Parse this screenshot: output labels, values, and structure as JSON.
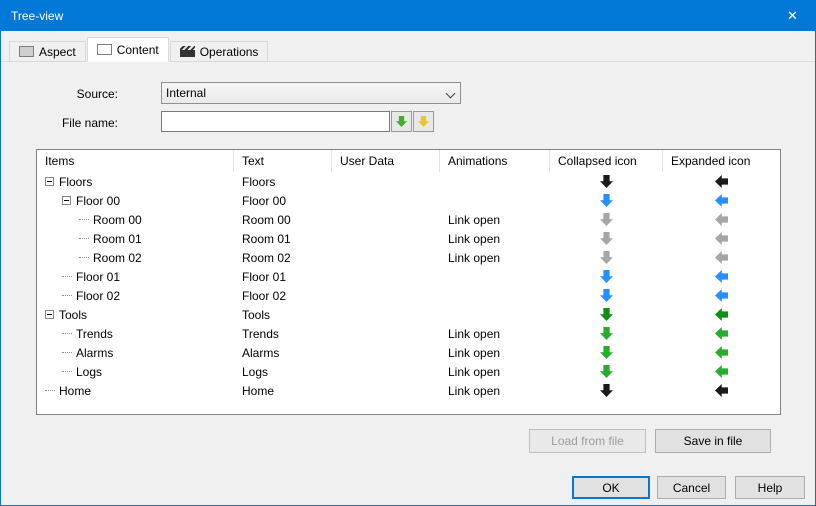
{
  "window": {
    "title": "Tree-view",
    "close_glyph": "✕"
  },
  "tabs": [
    {
      "label": "Aspect"
    },
    {
      "label": "Content"
    },
    {
      "label": "Operations"
    }
  ],
  "form": {
    "source_label": "Source:",
    "source_value": "Internal",
    "filename_label": "File name:",
    "filename_value": ""
  },
  "table": {
    "columns": [
      "Items",
      "Text",
      "User Data",
      "Animations",
      "Collapsed icon",
      "Expanded icon"
    ],
    "rows": [
      {
        "item": "Floors",
        "level": 0,
        "expander": true,
        "text": "Floors",
        "user_data": "",
        "animations": "",
        "arrow_color": "#1a1a1a"
      },
      {
        "item": "Floor 00",
        "level": 1,
        "expander": true,
        "text": "Floor 00",
        "user_data": "",
        "animations": "",
        "arrow_color": "#2491ff"
      },
      {
        "item": "Room 00",
        "level": 2,
        "expander": false,
        "text": "Room 00",
        "user_data": "",
        "animations": "Link open",
        "arrow_color": "#a6a6a6"
      },
      {
        "item": "Room 01",
        "level": 2,
        "expander": false,
        "text": "Room 01",
        "user_data": "",
        "animations": "Link open",
        "arrow_color": "#a6a6a6"
      },
      {
        "item": "Room 02",
        "level": 2,
        "expander": false,
        "text": "Room 02",
        "user_data": "",
        "animations": "Link open",
        "arrow_color": "#a6a6a6"
      },
      {
        "item": "Floor 01",
        "level": 1,
        "expander": false,
        "text": "Floor 01",
        "user_data": "",
        "animations": "",
        "arrow_color": "#2491ff"
      },
      {
        "item": "Floor 02",
        "level": 1,
        "expander": false,
        "text": "Floor 02",
        "user_data": "",
        "animations": "",
        "arrow_color": "#2491ff"
      },
      {
        "item": "Tools",
        "level": 0,
        "expander": true,
        "text": "Tools",
        "user_data": "",
        "animations": "",
        "arrow_color": "#0e8f12"
      },
      {
        "item": "Trends",
        "level": 1,
        "expander": false,
        "text": "Trends",
        "user_data": "",
        "animations": "Link open",
        "arrow_color": "#27ad2b"
      },
      {
        "item": "Alarms",
        "level": 1,
        "expander": false,
        "text": "Alarms",
        "user_data": "",
        "animations": "Link open",
        "arrow_color": "#27ad2b"
      },
      {
        "item": "Logs",
        "level": 1,
        "expander": false,
        "text": "Logs",
        "user_data": "",
        "animations": "Link open",
        "arrow_color": "#27ad2b"
      },
      {
        "item": "Home",
        "level": 0,
        "expander": false,
        "text": "Home",
        "user_data": "",
        "animations": "Link open",
        "arrow_color": "#1a1a1a"
      }
    ]
  },
  "buttons": {
    "load_from_file": "Load from file",
    "save_in_file": "Save in file",
    "ok": "OK",
    "cancel": "Cancel",
    "help": "Help"
  },
  "colors": {
    "titlebar": "#0078d7",
    "accent": "#0078d7"
  }
}
